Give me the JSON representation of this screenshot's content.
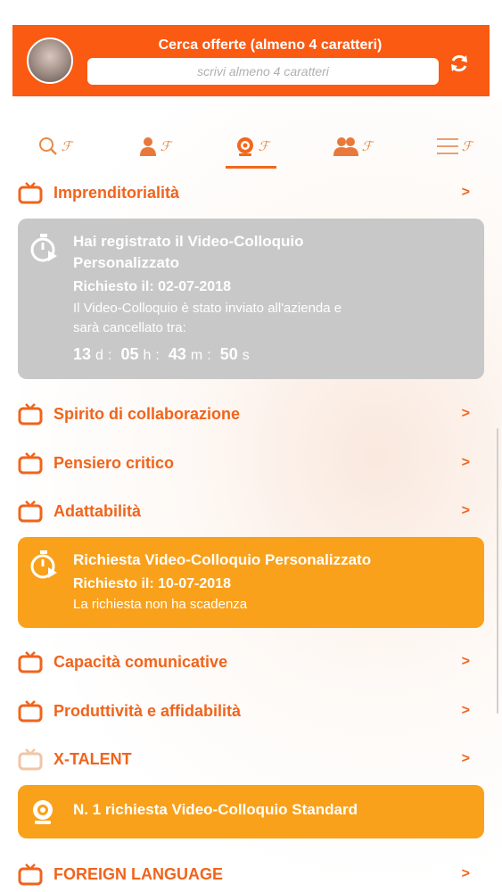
{
  "header": {
    "title": "Cerca offerte (almeno 4 caratteri)",
    "search_placeholder": "scrivi almeno 4 caratteri",
    "search_value": "",
    "refresh_icon": "refresh-icon"
  },
  "tabs": [
    {
      "icon": "search-icon",
      "sup": "ℱ"
    },
    {
      "icon": "user-icon",
      "sup": "ℱ"
    },
    {
      "icon": "webcam-icon",
      "sup": "ℱ",
      "active": true
    },
    {
      "icon": "group-icon",
      "sup": "ℱ"
    },
    {
      "icon": "menu-icon",
      "sup": "ℱ"
    }
  ],
  "items": {
    "imprenditorialita": "Imprenditorialità",
    "spirito": "Spirito di collaborazione",
    "pensiero": "Pensiero critico",
    "adattabilita": "Adattabilità",
    "capacita": "Capacità comunicative",
    "produttivita": "Produttività e affidabilità",
    "xtalent": "X-TALENT",
    "foreign": "FOREIGN LANGUAGE",
    "chevron": ">"
  },
  "card_registered": {
    "title_line1": "Hai registrato il Video-Colloquio",
    "title_line2": "Personalizzato",
    "requested": "Richiesto il: 02-07-2018",
    "message_line1": "Il Video-Colloquio è stato inviato all'azienda e",
    "message_line2": "sarà cancellato tra:",
    "countdown": {
      "days": "13",
      "days_unit": "d",
      "hours": "05",
      "hours_unit": "h",
      "minutes": "43",
      "minutes_unit": "m",
      "seconds": "50",
      "seconds_unit": "s",
      "separator": ":"
    }
  },
  "card_request": {
    "title": "Richiesta Video-Colloquio Personalizzato",
    "requested": "Richiesto il: 10-07-2018",
    "note": "La richiesta non ha scadenza"
  },
  "card_standard": {
    "title": "N. 1 richiesta Video-Colloquio Standard"
  },
  "colors": {
    "header_orange": "#fa5a12",
    "text_orange": "#f0641c",
    "card_gray": "#c8c8c8",
    "card_orange": "#f9a11b"
  }
}
